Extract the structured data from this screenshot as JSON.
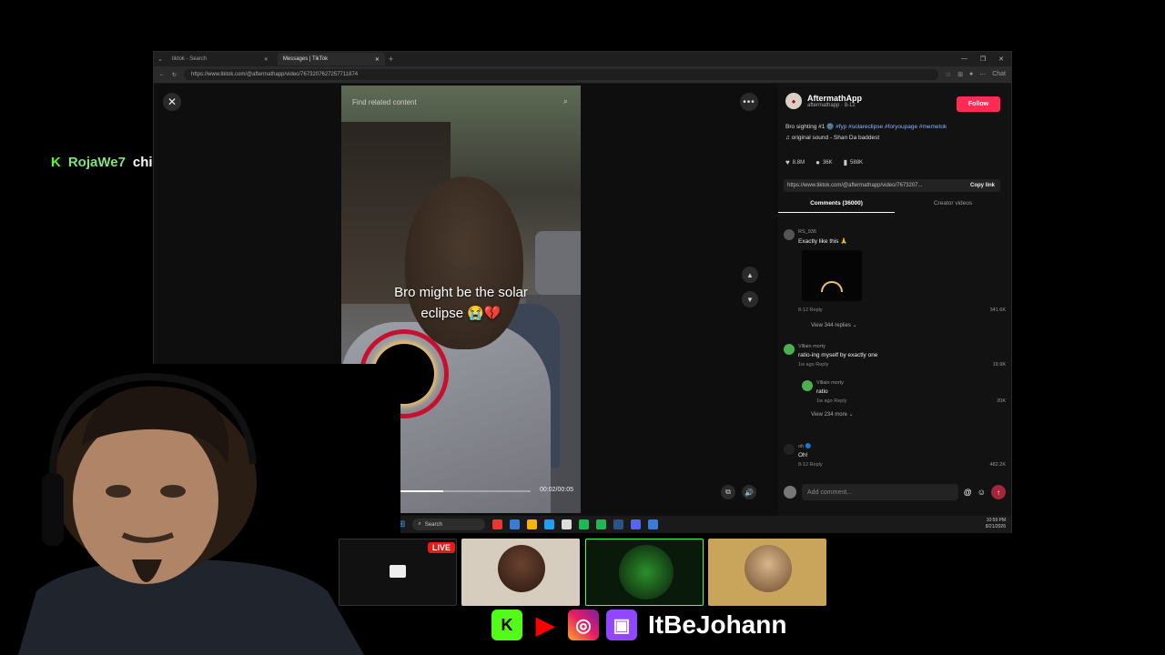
{
  "chat": {
    "platform_icon": "K",
    "username": "RojaWe7",
    "message": "chill dawg"
  },
  "browser": {
    "tabs": [
      {
        "label": "tiktok - Search",
        "active": false
      },
      {
        "label": "Messages | TikTok",
        "active": true
      }
    ],
    "url": "https://www.tiktok.com/@aftermathapp/video/7673207627257711874",
    "copilot_label": "Chat"
  },
  "video": {
    "related_placeholder": "Find related content",
    "caption_line1": "Bro might be the solar",
    "caption_line2": "eclipse 😭💔",
    "progress": 0.52,
    "time": "00:02/00:05"
  },
  "post": {
    "author_name": "AftermathApp",
    "author_handle": "aftermathapp · 8-12",
    "follow_label": "Follow",
    "description_text": "Bro sighting #1 🌚",
    "description_tags": "#fyp #solareclipse #foryoupage #memetok",
    "sound": "♫ original sound - Shan Da baddest",
    "likes": "8.8M",
    "comments_count": "36K",
    "saves": "588K",
    "link": "https://www.tiktok.com/@aftermathapp/video/7673207...",
    "copy_label": "Copy link",
    "tab_comments": "Comments (36000)",
    "tab_creator": "Creator videos"
  },
  "comments": [
    {
      "name": "RS_936",
      "text": "Exactly like this 🙏",
      "meta": "8-12   Reply",
      "likes": "341.6K",
      "replies": "View 344 replies ⌄"
    },
    {
      "name": "Villain morty",
      "text": "ratio-ing myself by exactly one",
      "meta": "1w ago   Reply",
      "likes": "19.9K"
    },
    {
      "name": "Villain morty",
      "text": "ratio",
      "meta": "1w ago   Reply",
      "likes": "20K",
      "replies": "View 234 more ⌄"
    },
    {
      "name": "oh 🔵",
      "text": "Oh!",
      "meta": "8-12   Reply",
      "likes": "482.2K"
    }
  ],
  "add_comment_placeholder": "Add comment...",
  "taskbar": {
    "search": "Search",
    "time": "10:59 PM",
    "date": "8/21/2026"
  },
  "stream": {
    "live_badge": "LIVE",
    "handle": "ItBeJohann"
  },
  "colors": {
    "kick_green": "#53fc18",
    "tiktok_red": "#fe2c55",
    "twitch_purple": "#9146ff",
    "youtube_red": "#ff0000"
  }
}
